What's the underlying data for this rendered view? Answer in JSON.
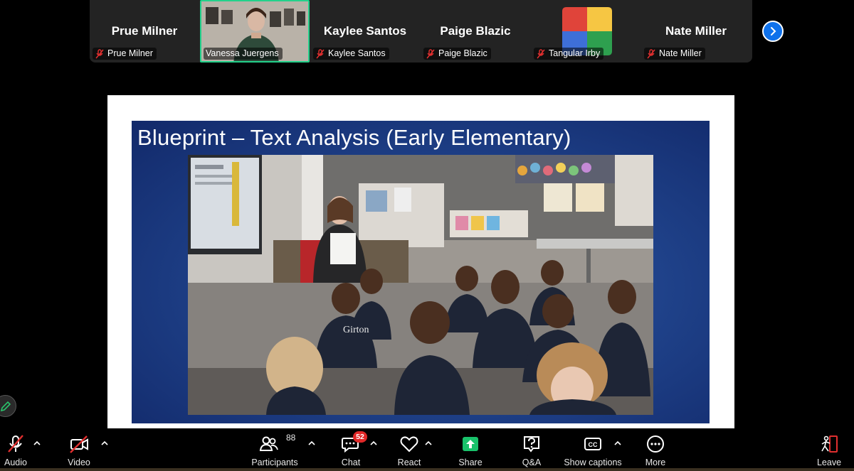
{
  "participants": [
    {
      "big_name": "Prue Milner",
      "label": "Prue Milner",
      "muted": true
    },
    {
      "big_name": "",
      "label": "Vanessa Juergens",
      "muted": false,
      "video": true
    },
    {
      "big_name": "Kaylee Santos",
      "label": "Kaylee Santos",
      "muted": true
    },
    {
      "big_name": "Paige Blazic",
      "label": "Paige Blazic",
      "muted": true
    },
    {
      "big_name": "",
      "label": "Tangular Irby",
      "muted": true,
      "logo": true
    },
    {
      "big_name": "Nate Miller",
      "label": "Nate Miller",
      "muted": true
    }
  ],
  "slide": {
    "title": "Blueprint – Text Analysis (Early Elementary)",
    "shirt_text": "Girton"
  },
  "toolbar": {
    "audio": "Audio",
    "video": "Video",
    "participants": "Participants",
    "participants_count": "88",
    "chat": "Chat",
    "chat_badge": "52",
    "react": "React",
    "share": "Share",
    "qa": "Q&A",
    "captions": "Show captions",
    "more": "More",
    "leave": "Leave"
  },
  "colors": {
    "active_speaker": "#23d18b",
    "next_button": "#0e71eb",
    "share_green": "#19c26b",
    "badge_red": "#e02828",
    "mute_red": "#e02f2f"
  }
}
